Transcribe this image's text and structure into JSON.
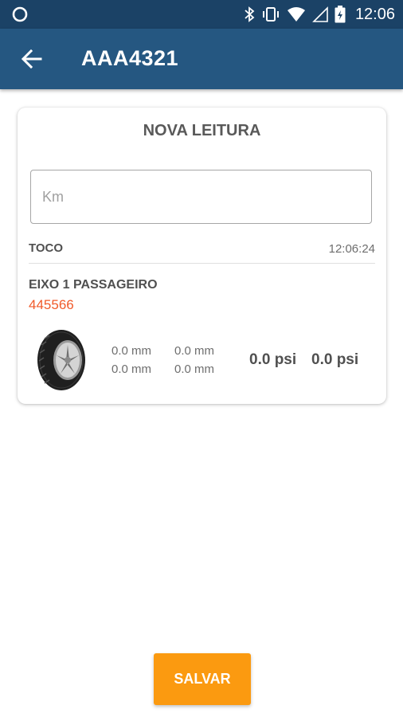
{
  "status_bar": {
    "time": "12:06",
    "icons": [
      "record-icon",
      "bluetooth-icon",
      "vibrate-icon",
      "wifi-icon",
      "signal-icon",
      "battery-icon"
    ]
  },
  "app_bar": {
    "title": "AAA4321",
    "back_icon": "arrow-back-icon",
    "color": "#255781"
  },
  "card": {
    "title": "NOVA LEITURA",
    "km_input": {
      "placeholder": "Km",
      "value": ""
    },
    "vehicle_type": "TOCO",
    "read_time": "12:06:24",
    "axle": {
      "name": "EIXO 1 PASSAGEIRO",
      "code": "445566",
      "code_color": "#f05a2a",
      "tire_icon": "tire-icon",
      "depths": {
        "left_top": "0.0 mm",
        "left_bottom": "0.0 mm",
        "right_top": "0.0 mm",
        "right_bottom": "0.0 mm"
      },
      "pressure_left": "0.0 psi",
      "pressure_right": "0.0 psi"
    }
  },
  "save_button": {
    "label": "SALVAR",
    "color": "#fb9a10"
  }
}
